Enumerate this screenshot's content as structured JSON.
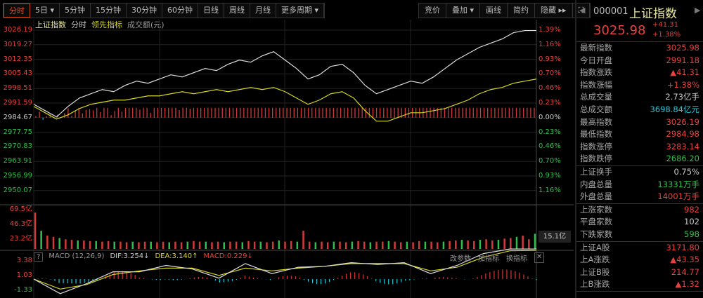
{
  "toolbar": {
    "periods": [
      "分时",
      "5日 ▾",
      "5分钟",
      "15分钟",
      "30分钟",
      "60分钟",
      "日线",
      "周线",
      "月线",
      "更多周期 ▾"
    ],
    "right": [
      "竞价",
      "叠加 ▾",
      "画线",
      "简约",
      "隐藏 ▸▸",
      "⛶"
    ]
  },
  "legend": {
    "name": "上证指数",
    "mode": "分时",
    "leading": "领先指标",
    "amount": "成交额(元)"
  },
  "price_axis": [
    "3026.19",
    "3019.27",
    "3012.35",
    "3005.43",
    "2998.51",
    "2991.59",
    "2984.67",
    "2977.75",
    "2970.83",
    "2963.91",
    "2956.99",
    "2950.07"
  ],
  "pct_axis": [
    "1.39%",
    "1.16%",
    "0.93%",
    "0.70%",
    "0.46%",
    "0.23%",
    "0.00%",
    "0.23%",
    "0.46%",
    "0.70%",
    "0.93%",
    "1.16%"
  ],
  "vol_axis": [
    "69.5亿",
    "46.3亿",
    "23.2亿"
  ],
  "vol_badge": "15.1亿",
  "macd": {
    "help": "?",
    "name": "MACD (12,26,9)",
    "dif": "DIF:3.254↓",
    "dea": "DEA:3.140↑",
    "macd": "MACD:0.229↓",
    "axis": [
      "3.38",
      "1.03",
      "-1.33"
    ],
    "actions": [
      "改参数",
      "加指标",
      "换指标",
      "✕"
    ]
  },
  "chart_data": {
    "type": "line",
    "prev_close": 2984.67,
    "ylim": [
      2947,
      3029
    ],
    "price": [
      2991,
      2988,
      2985,
      2990,
      2994,
      2996,
      2998,
      2997,
      3000,
      3002,
      3001,
      3003,
      3005,
      3004,
      3006,
      3008,
      3007,
      3010,
      3012,
      3011,
      3014,
      3016,
      3012,
      3008,
      3003,
      3005,
      3009,
      3010,
      3006,
      3000,
      2996,
      2998,
      3000,
      3002,
      3001,
      3004,
      3008,
      3012,
      3015,
      3018,
      3020,
      3022,
      3025,
      3026,
      3026
    ],
    "leading": [
      2990,
      2987,
      2984,
      2986,
      2989,
      2991,
      2992,
      2993,
      2993,
      2994,
      2995,
      2995,
      2996,
      2997,
      2996,
      2997,
      2998,
      2997,
      2998,
      2999,
      2998,
      2999,
      2997,
      2994,
      2991,
      2993,
      2996,
      2997,
      2994,
      2988,
      2983,
      2983,
      2985,
      2987,
      2987,
      2988,
      2989,
      2991,
      2993,
      2996,
      2998,
      2999,
      3001,
      3002,
      3003
    ],
    "volume": [
      60,
      30,
      22,
      20,
      18,
      16,
      15,
      14,
      14,
      13,
      13,
      12,
      13,
      12,
      12,
      11,
      12,
      11,
      12,
      12,
      11,
      12,
      11,
      12,
      11,
      12,
      13,
      12,
      12,
      11,
      12,
      11,
      12,
      12,
      11,
      13,
      12,
      12,
      11,
      12,
      14,
      12,
      13,
      12,
      30,
      12,
      11,
      12,
      11,
      12,
      12,
      11,
      12,
      13,
      12,
      11,
      12,
      12,
      13,
      12,
      11,
      12,
      11,
      13,
      12,
      12,
      11,
      12,
      13,
      14,
      15,
      14,
      13,
      15,
      16,
      14,
      15,
      17,
      18,
      20,
      22,
      16,
      25
    ],
    "macd_dif": [
      0,
      -1.6,
      -0.5,
      0.8,
      0.8,
      1.5,
      1.1,
      0.1,
      1.7,
      0.6,
      1.3,
      1.4,
      1.8,
      1.6,
      1.8,
      0.6,
      1.5,
      2.8,
      3.3,
      3.3
    ],
    "macd_dea": [
      0,
      -1.1,
      -0.6,
      0.5,
      0.9,
      1.2,
      1.2,
      0.4,
      1.2,
      0.9,
      1.2,
      1.4,
      1.7,
      1.7,
      1.7,
      0.9,
      1.3,
      2.4,
      3.1,
      3.14
    ]
  },
  "panel": {
    "code": "000001",
    "name": "上证指数",
    "price": "3025.98",
    "chg": "+41.31",
    "pct": "+1.38%",
    "rows1": [
      [
        "最新指数",
        "3025.98",
        "red"
      ],
      [
        "今日开盘",
        "2991.18",
        "red"
      ],
      [
        "指数涨跌",
        "▲41.31",
        "red"
      ],
      [
        "指数涨幅",
        "+1.38%",
        "red"
      ],
      [
        "总成交量",
        "2.73亿手",
        "white"
      ],
      [
        "总成交额",
        "3698.84亿元",
        "cyan"
      ],
      [
        "最高指数",
        "3026.19",
        "red"
      ],
      [
        "最低指数",
        "2984.98",
        "red"
      ],
      [
        "指数涨停",
        "3283.14",
        "red"
      ],
      [
        "指数跌停",
        "2686.20",
        "green"
      ]
    ],
    "rows2": [
      [
        "上证换手",
        "0.75%",
        "white"
      ],
      [
        "内盘总量",
        "13331万手",
        "green"
      ],
      [
        "外盘总量",
        "14001万手",
        "red"
      ]
    ],
    "rows3": [
      [
        "上涨家数",
        "982",
        "red"
      ],
      [
        "平盘家数",
        "102",
        "white"
      ],
      [
        "下跌家数",
        "598",
        "green"
      ]
    ],
    "rows4": [
      [
        "上证A股",
        "3171.80",
        "red"
      ],
      [
        "上A涨跌",
        "▲43.35",
        "red"
      ],
      [
        "上证B股",
        "214.77",
        "red"
      ],
      [
        "上B涨跌",
        "▲1.32",
        "red"
      ]
    ]
  }
}
